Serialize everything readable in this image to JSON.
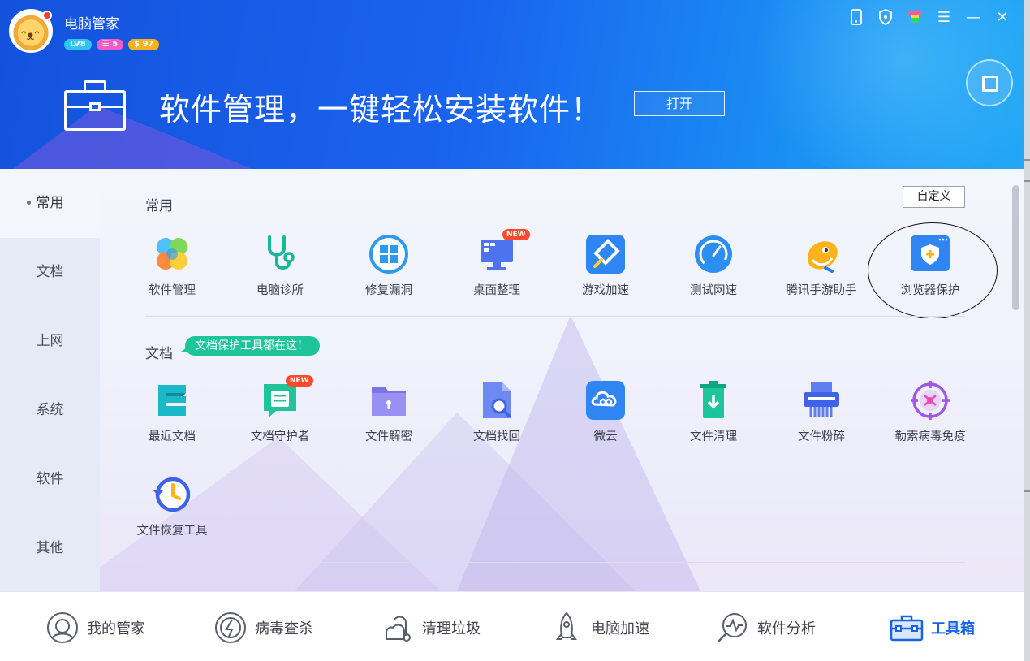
{
  "app": {
    "title": "电脑管家",
    "badges": {
      "level": "LV8",
      "vip": "☰ 5",
      "coins": "$ 97"
    }
  },
  "banner": {
    "promo_text": "软件管理，一键轻松安装软件！",
    "open_button": "打开"
  },
  "sidebar": {
    "items": [
      {
        "label": "常用",
        "active": true
      },
      {
        "label": "文档"
      },
      {
        "label": "上网"
      },
      {
        "label": "系统"
      },
      {
        "label": "软件"
      },
      {
        "label": "其他"
      }
    ]
  },
  "content": {
    "custom_button": "自定义",
    "common": {
      "title": "常用",
      "tools": [
        {
          "label": "软件管理",
          "icon": "clover-icon"
        },
        {
          "label": "电脑诊所",
          "icon": "stethoscope-icon"
        },
        {
          "label": "修复漏洞",
          "icon": "windows-repair-icon"
        },
        {
          "label": "桌面整理",
          "icon": "desktop-organize-icon",
          "new": "NEW"
        },
        {
          "label": "游戏加速",
          "icon": "game-boost-icon"
        },
        {
          "label": "测试网速",
          "icon": "speedometer-icon"
        },
        {
          "label": "腾讯手游助手",
          "icon": "mobile-game-assistant-icon"
        },
        {
          "label": "浏览器保护",
          "icon": "browser-shield-icon"
        }
      ]
    },
    "docs": {
      "title": "文档",
      "tag": "文档保护工具都在这！",
      "tools": [
        {
          "label": "最近文档",
          "icon": "recent-docs-icon"
        },
        {
          "label": "文档守护者",
          "icon": "doc-guardian-icon",
          "new": "NEW"
        },
        {
          "label": "文件解密",
          "icon": "file-decrypt-icon"
        },
        {
          "label": "文档找回",
          "icon": "doc-recovery-icon"
        },
        {
          "label": "微云",
          "icon": "weiyun-cloud-icon"
        },
        {
          "label": "文件清理",
          "icon": "file-clean-icon"
        },
        {
          "label": "文件粉碎",
          "icon": "file-shredder-icon"
        },
        {
          "label": "勒索病毒免疫",
          "icon": "ransomware-immunity-icon"
        },
        {
          "label": "文件恢复工具",
          "icon": "file-restore-icon"
        }
      ]
    }
  },
  "bottom_nav": [
    {
      "label": "我的管家",
      "icon": "my-manager-icon"
    },
    {
      "label": "病毒查杀",
      "icon": "virus-scan-icon"
    },
    {
      "label": "清理垃圾",
      "icon": "clean-junk-icon"
    },
    {
      "label": "电脑加速",
      "icon": "rocket-icon"
    },
    {
      "label": "软件分析",
      "icon": "software-analysis-icon"
    },
    {
      "label": "工具箱",
      "icon": "toolbox-icon",
      "active": true
    }
  ],
  "colors": {
    "header_blue": "#1a63ee",
    "accent_blue": "#1664e6",
    "doc_tag_green": "#1ec59a",
    "new_badge_red": "#ff4b2b"
  }
}
